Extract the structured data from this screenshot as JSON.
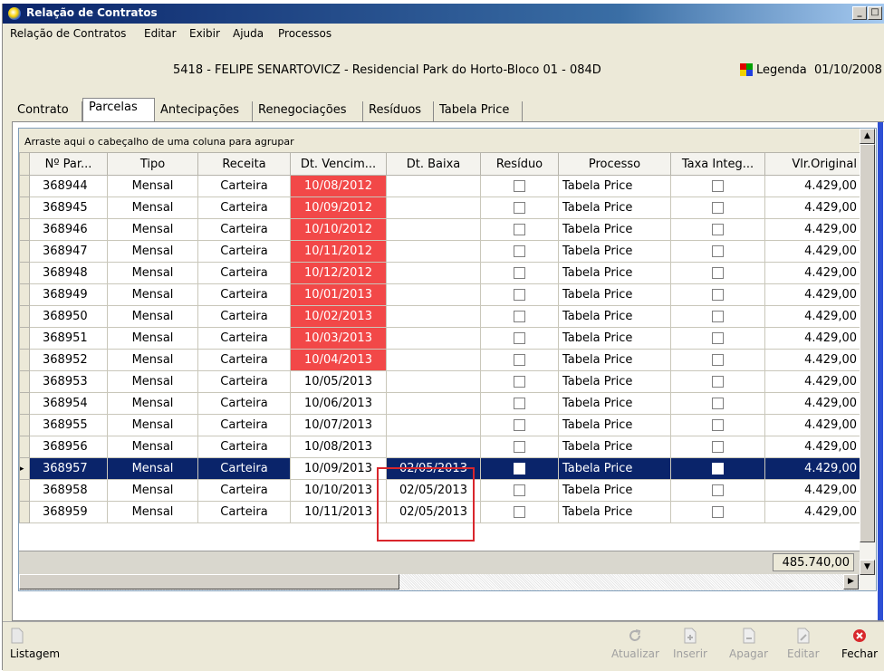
{
  "window": {
    "title": "Relação de Contratos"
  },
  "menu": [
    "Relação de Contratos",
    "Editar",
    "Exibir",
    "Ajuda",
    "Processos"
  ],
  "header": {
    "contract_info": "5418 - FELIPE SENARTOVICZ - Residencial Park do Horto-Bloco 01 - 084D",
    "legend_label": "Legenda",
    "date": "01/10/2008"
  },
  "tabs": [
    "Contrato",
    "Parcelas",
    "Antecipações",
    "Renegociações",
    "Resíduos",
    "Tabela Price"
  ],
  "active_tab": "Parcelas",
  "grid": {
    "group_hint": "Arraste aqui o cabeçalho de uma coluna para agrupar",
    "columns": [
      "Nº Par...",
      "Tipo",
      "Receita",
      "Dt. Vencim...",
      "Dt. Baixa",
      "Resíduo",
      "Processo",
      "Taxa Integ...",
      "Vlr.Original"
    ],
    "rows": [
      [
        "368944",
        "Mensal",
        "Carteira",
        "10/08/2012",
        "",
        "",
        "Tabela Price",
        "",
        "4.429,00"
      ],
      [
        "368945",
        "Mensal",
        "Carteira",
        "10/09/2012",
        "",
        "",
        "Tabela Price",
        "",
        "4.429,00"
      ],
      [
        "368946",
        "Mensal",
        "Carteira",
        "10/10/2012",
        "",
        "",
        "Tabela Price",
        "",
        "4.429,00"
      ],
      [
        "368947",
        "Mensal",
        "Carteira",
        "10/11/2012",
        "",
        "",
        "Tabela Price",
        "",
        "4.429,00"
      ],
      [
        "368948",
        "Mensal",
        "Carteira",
        "10/12/2012",
        "",
        "",
        "Tabela Price",
        "",
        "4.429,00"
      ],
      [
        "368949",
        "Mensal",
        "Carteira",
        "10/01/2013",
        "",
        "",
        "Tabela Price",
        "",
        "4.429,00"
      ],
      [
        "368950",
        "Mensal",
        "Carteira",
        "10/02/2013",
        "",
        "",
        "Tabela Price",
        "",
        "4.429,00"
      ],
      [
        "368951",
        "Mensal",
        "Carteira",
        "10/03/2013",
        "",
        "",
        "Tabela Price",
        "",
        "4.429,00"
      ],
      [
        "368952",
        "Mensal",
        "Carteira",
        "10/04/2013",
        "",
        "",
        "Tabela Price",
        "",
        "4.429,00"
      ],
      [
        "368953",
        "Mensal",
        "Carteira",
        "10/05/2013",
        "",
        "",
        "Tabela Price",
        "",
        "4.429,00"
      ],
      [
        "368954",
        "Mensal",
        "Carteira",
        "10/06/2013",
        "",
        "",
        "Tabela Price",
        "",
        "4.429,00"
      ],
      [
        "368955",
        "Mensal",
        "Carteira",
        "10/07/2013",
        "",
        "",
        "Tabela Price",
        "",
        "4.429,00"
      ],
      [
        "368956",
        "Mensal",
        "Carteira",
        "10/08/2013",
        "",
        "",
        "Tabela Price",
        "",
        "4.429,00"
      ],
      [
        "368957",
        "Mensal",
        "Carteira",
        "10/09/2013",
        "02/05/2013",
        "",
        "Tabela Price",
        "",
        "4.429,00"
      ],
      [
        "368958",
        "Mensal",
        "Carteira",
        "10/10/2013",
        "02/05/2013",
        "",
        "Tabela Price",
        "",
        "4.429,00"
      ],
      [
        "368959",
        "Mensal",
        "Carteira",
        "10/11/2013",
        "02/05/2013",
        "",
        "Tabela Price",
        "",
        "4.429,00"
      ]
    ],
    "overdue_rows": 9,
    "selected_row": 13,
    "total": "485.740,00"
  },
  "colors": {
    "overdue": "#f24848",
    "selection": "#0a246a",
    "highlight_box": "#d9262c"
  },
  "toolbar": {
    "listagem": "Listagem",
    "atualizar": "Atualizar",
    "inserir": "Inserir",
    "apagar": "Apagar",
    "editar": "Editar",
    "fechar": "Fechar"
  },
  "icons": [
    "app-icon",
    "minimize-icon",
    "maximize-icon",
    "close-icon",
    "legend-icon",
    "document-icon",
    "refresh-icon",
    "insert-icon",
    "delete-icon",
    "edit-icon",
    "close-red-icon",
    "scroll-up-icon",
    "scroll-down-icon",
    "scroll-left-icon",
    "scroll-right-icon"
  ]
}
